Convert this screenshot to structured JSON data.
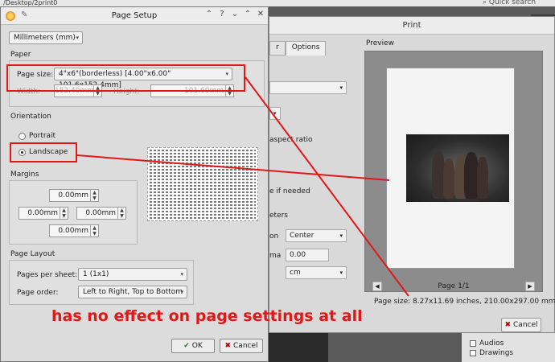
{
  "background": {
    "path": "/Desktop/2print0",
    "search": "Quick search",
    "list_items": [
      "Audios",
      "Drawings"
    ]
  },
  "print_dialog": {
    "title": "Print",
    "tabs": [
      "r",
      "Options"
    ],
    "preview_label": "Preview",
    "fragments": {
      "aspect": "aspect ratio",
      "if_needed": "e if needed",
      "meters": "eters",
      "on": "on",
      "ma": "ma"
    },
    "combos": {
      "center": "Center",
      "value": "0.00",
      "unit": "cm"
    },
    "page_label": "Page 1/1",
    "page_size_info": "Page size: 8.27x11.69 inches, 210.00x297.00 mm",
    "cancel": "Cancel"
  },
  "page_setup": {
    "title": "Page Setup",
    "units": "Millimeters (mm)",
    "paper": {
      "heading": "Paper",
      "size_label": "Page size:",
      "size_value": "4\"x6\"(borderless) [4.00\"x6.00\" 101.6x152.4mm]",
      "width_label": "Width:",
      "width_value": "152.40mm",
      "height_label": "Height:",
      "height_value": "101.60mm"
    },
    "orientation": {
      "heading": "Orientation",
      "portrait": "Portrait",
      "landscape": "Landscape"
    },
    "margins": {
      "heading": "Margins",
      "top": "0.00mm",
      "left": "0.00mm",
      "right": "0.00mm",
      "bottom": "0.00mm"
    },
    "layout": {
      "heading": "Page Layout",
      "pages_label": "Pages per sheet:",
      "pages_value": "1 (1x1)",
      "order_label": "Page order:",
      "order_value": "Left to Right, Top to Bottom"
    },
    "ok": "OK",
    "cancel": "Cancel"
  },
  "annotation": {
    "text": "has no effect on page settings at all",
    "color": "#e01818"
  }
}
